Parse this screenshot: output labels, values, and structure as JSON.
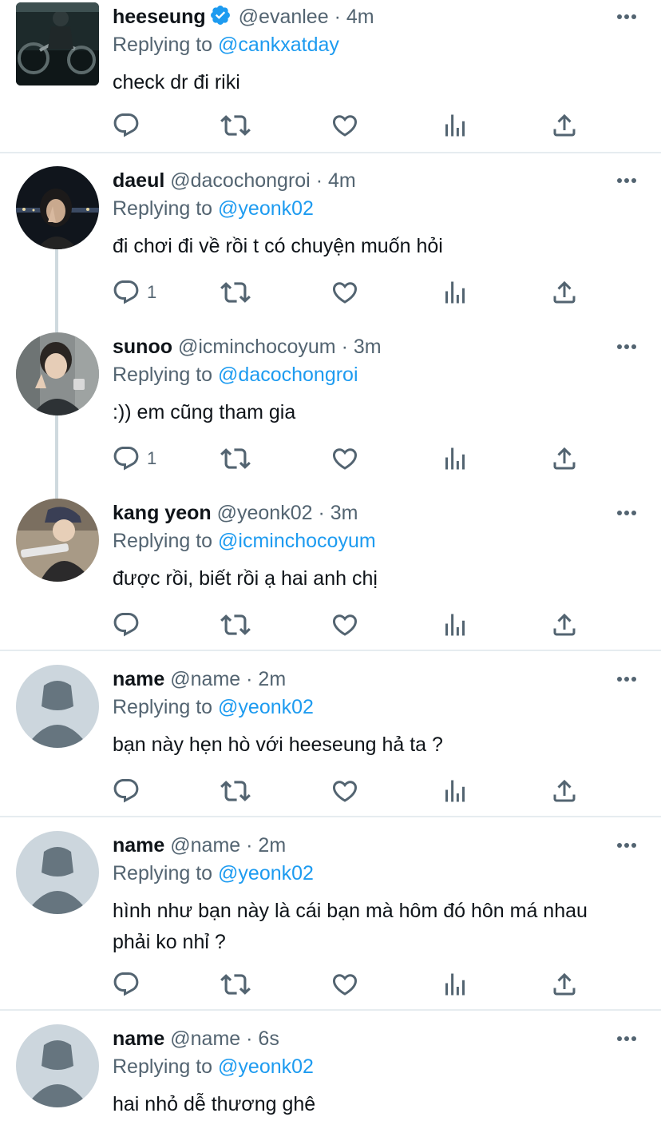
{
  "tweets": [
    {
      "name": "heeseung",
      "verified": true,
      "handle": "@evanlee",
      "time": "· 4m",
      "replying_prefix": "Replying to",
      "replying_to": "@cankxatday",
      "text": "check dr đi riki",
      "reply_count": "",
      "avatar": "photo-motorcycle"
    },
    {
      "name": "daeul",
      "verified": false,
      "handle": "@dacochongroi",
      "time": "· 4m",
      "replying_prefix": "Replying to",
      "replying_to": "@yeonk02",
      "text": "đi chơi đi về rồi t có chuyện muốn hỏi",
      "reply_count": "1",
      "avatar": "photo-girl-night"
    },
    {
      "name": "sunoo",
      "verified": false,
      "handle": "@icminchocoyum",
      "time": "· 3m",
      "replying_prefix": "Replying to",
      "replying_to": "@dacochongroi",
      "text": ":)) em cũng tham gia",
      "reply_count": "1",
      "avatar": "photo-boy-peace"
    },
    {
      "name": "kang yeon",
      "verified": false,
      "handle": "@yeonk02",
      "time": "· 3m",
      "replying_prefix": "Replying to",
      "replying_to": "@icminchocoyum",
      "text": "được rồi, biết rồi ạ hai anh chị",
      "reply_count": "",
      "avatar": "photo-cap-tablet"
    },
    {
      "name": "name",
      "verified": false,
      "handle": "@name",
      "time": "· 2m",
      "replying_prefix": "Replying to",
      "replying_to": "@yeonk02",
      "text": "bạn này hẹn hò với heeseung hả ta ?",
      "reply_count": "",
      "avatar": "default-avatar"
    },
    {
      "name": "name",
      "verified": false,
      "handle": "@name",
      "time": "· 2m",
      "replying_prefix": "Replying to",
      "replying_to": "@yeonk02",
      "text": "hình như bạn này là cái bạn mà hôm đó hôn má nhau phải ko nhỉ ?",
      "reply_count": "",
      "avatar": "default-avatar"
    },
    {
      "name": "name",
      "verified": false,
      "handle": "@name",
      "time": "· 6s",
      "replying_prefix": "Replying to",
      "replying_to": "@yeonk02",
      "text": "hai nhỏ dễ thương ghê",
      "reply_count": "",
      "avatar": "default-avatar"
    }
  ],
  "colors": {
    "link": "#1d9bf0",
    "secondary": "#536471",
    "text": "#0f1419",
    "verified": "#1d9bf0",
    "thread_line": "#cfd9de",
    "divider": "#e6ecf0"
  },
  "icons": [
    "reply-icon",
    "retweet-icon",
    "like-icon",
    "views-icon",
    "share-icon",
    "more-icon",
    "verified-badge-icon"
  ]
}
